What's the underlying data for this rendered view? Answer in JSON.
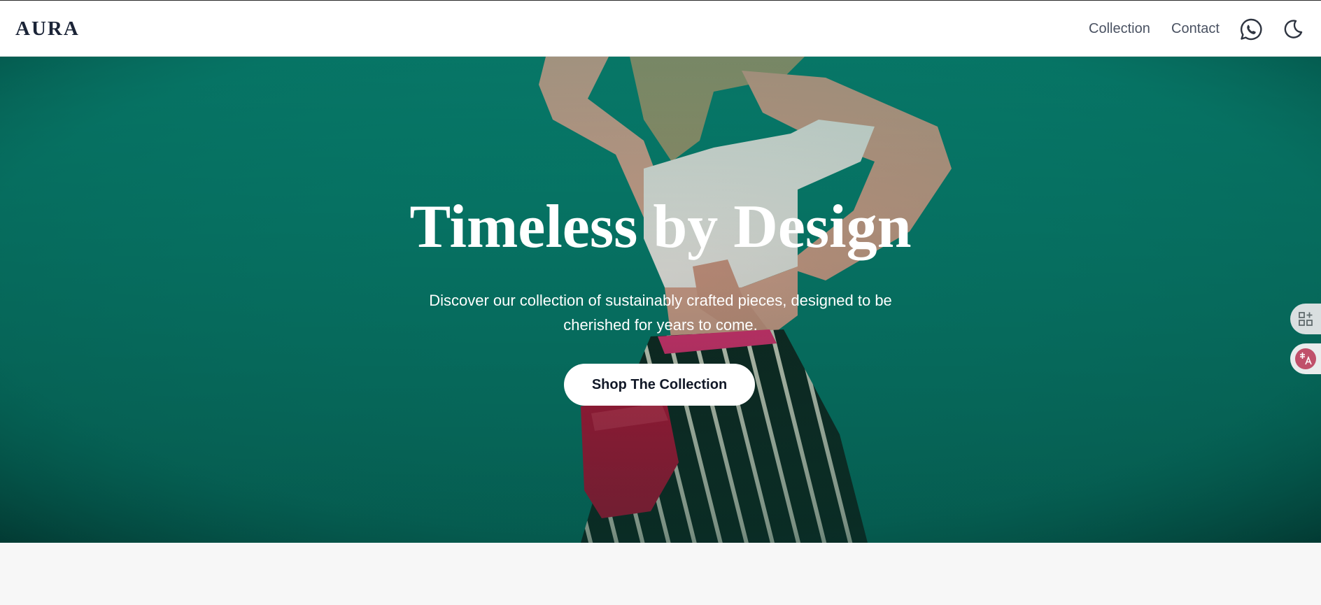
{
  "brand": {
    "logo": "AURA"
  },
  "nav": {
    "links": [
      "Collection",
      "Contact"
    ],
    "icons": [
      "whatsapp-icon",
      "moon-icon"
    ]
  },
  "hero": {
    "title": "Timeless by Design",
    "subtitle_line1": "Discover our collection of sustainably crafted pieces, designed to be",
    "subtitle_line2": "cherished for years to come.",
    "cta_label": "Shop The Collection"
  },
  "side_widgets": [
    "apps-add-icon",
    "translate-icon"
  ],
  "colors": {
    "hero_background": "#07806f",
    "text_dark": "#1b2437",
    "nav_link": "#4a5262",
    "cta_background": "#ffffff",
    "page_background": "#f7f7f7"
  }
}
